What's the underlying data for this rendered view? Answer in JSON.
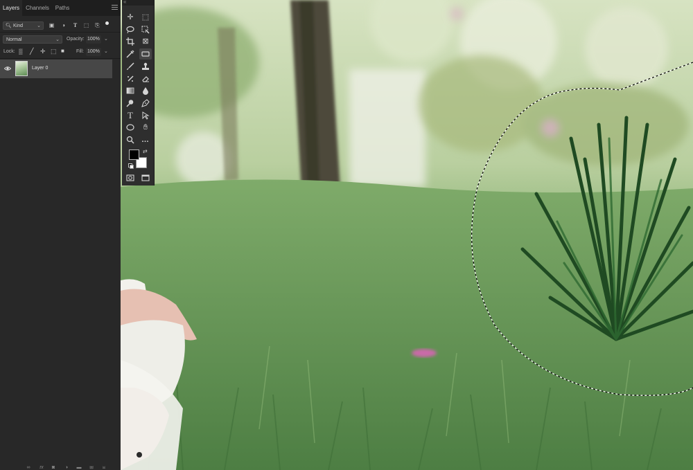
{
  "layers_panel": {
    "tabs": [
      {
        "label": "Layers",
        "active": true
      },
      {
        "label": "Channels",
        "active": false
      },
      {
        "label": "Paths",
        "active": false
      }
    ],
    "filter": {
      "value": "Kind"
    },
    "blend_mode": {
      "value": "Normal"
    },
    "opacity": {
      "label": "Opacity:",
      "value": "100%"
    },
    "lock": {
      "label": "Lock:"
    },
    "fill": {
      "label": "Fill:",
      "value": "100%"
    },
    "layers": [
      {
        "name": "Layer 0",
        "visible": true,
        "selected": true
      }
    ],
    "bottom_icons": [
      "link-icon",
      "fx-icon",
      "mask-icon",
      "adjustment-icon",
      "group-folder-icon",
      "new-layer-icon",
      "trash-icon"
    ]
  },
  "toolbar": {
    "tools": [
      "move-tool",
      "marquee-tool",
      "lasso-tool",
      "object-select-tool",
      "crop-tool",
      "frame-tool",
      "eyedropper-tool",
      "spot-heal-tool",
      "brush-tool",
      "clone-stamp-tool",
      "history-brush-tool",
      "eraser-tool",
      "gradient-tool",
      "blur-tool",
      "dodge-tool",
      "pen-tool",
      "type-tool",
      "path-select-tool",
      "ellipse-tool",
      "hand-tool",
      "zoom-tool",
      "more-tools"
    ],
    "foreground_color": "#000000",
    "background_color": "#ffffff"
  },
  "canvas": {
    "selection": "elliptical marching-ants selection around palm plant"
  }
}
